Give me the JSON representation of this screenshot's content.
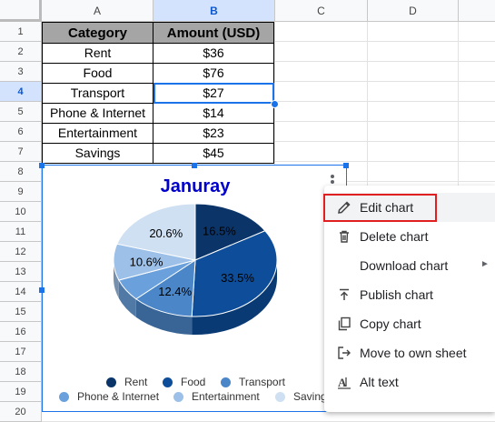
{
  "columns": [
    "A",
    "B",
    "C",
    "D"
  ],
  "rows": [
    "1",
    "2",
    "3",
    "4",
    "5",
    "6",
    "7",
    "8",
    "9",
    "10",
    "11",
    "12",
    "13",
    "14",
    "15",
    "16",
    "17",
    "18",
    "19",
    "20"
  ],
  "table": {
    "headers": [
      "Category",
      "Amount (USD)"
    ],
    "rows": [
      [
        "Rent",
        "$36"
      ],
      [
        "Food",
        "$76"
      ],
      [
        "Transport",
        "$27"
      ],
      [
        "Phone & Internet",
        "$14"
      ],
      [
        "Entertainment",
        "$23"
      ],
      [
        "Savings",
        "$45"
      ]
    ]
  },
  "chart_data": {
    "type": "pie",
    "title": "Januray",
    "categories": [
      "Rent",
      "Food",
      "Transport",
      "Phone & Internet",
      "Entertainment",
      "Savings"
    ],
    "values": [
      36,
      76,
      27,
      14,
      23,
      45
    ],
    "percent_labels": [
      "16.5%",
      "33.5%",
      "12.4%",
      "",
      "10.6%",
      "20.6%"
    ],
    "colors": [
      "#0b3569",
      "#0d4d99",
      "#4a86c8",
      "#6aa1dd",
      "#9dc0e8",
      "#cfe0f3"
    ],
    "style": "3d",
    "legend_position": "bottom"
  },
  "menu": {
    "items": [
      {
        "icon": "pencil-icon",
        "label": "Edit chart"
      },
      {
        "icon": "trash-icon",
        "label": "Delete chart"
      },
      {
        "icon": "",
        "label": "Download chart",
        "submenu": true
      },
      {
        "icon": "publish-icon",
        "label": "Publish chart"
      },
      {
        "icon": "copy-icon",
        "label": "Copy chart"
      },
      {
        "icon": "move-to-sheet-icon",
        "label": "Move to own sheet"
      },
      {
        "icon": "alt-text-icon",
        "label": "Alt text"
      }
    ],
    "submenu_arrow": "►"
  },
  "selection": {
    "column": "B",
    "row": "4"
  }
}
